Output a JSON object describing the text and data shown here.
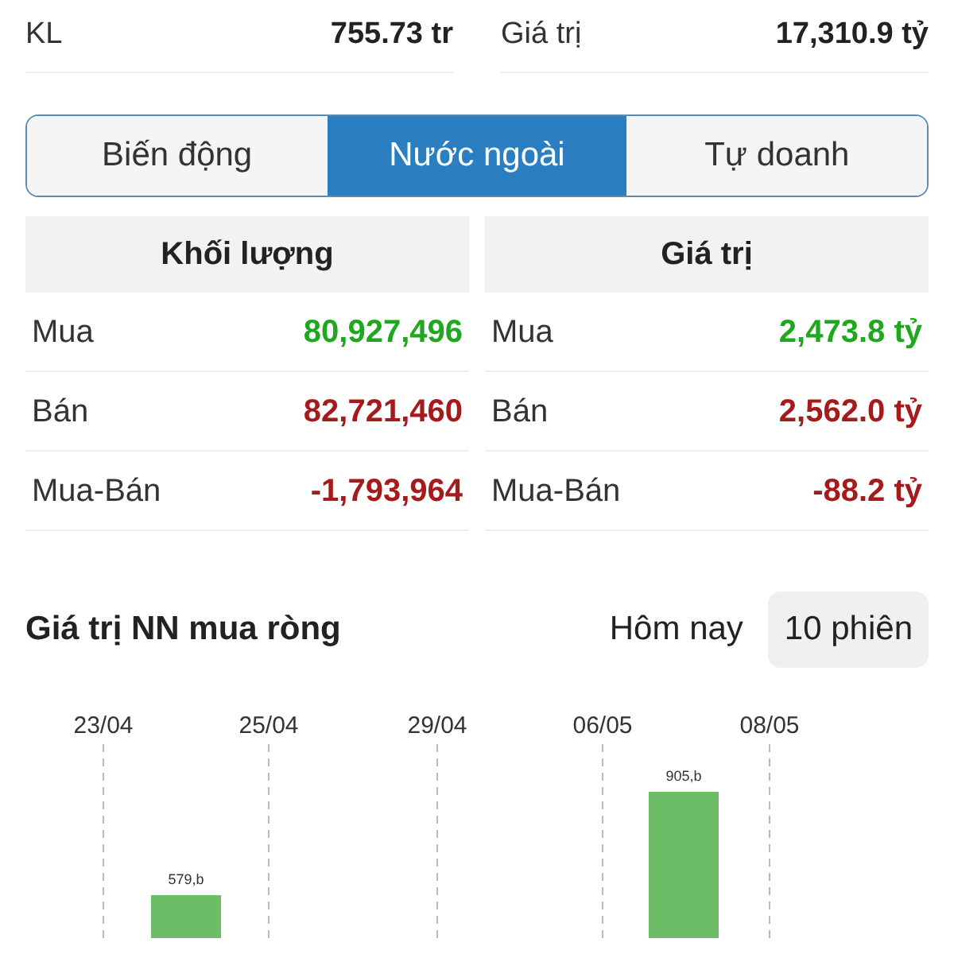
{
  "summary": [
    {
      "label": "KL",
      "value": "755.73 tr"
    },
    {
      "label": "Giá trị",
      "value": "17,310.9 tỷ"
    }
  ],
  "tabs": [
    {
      "label": "Biến động",
      "selected": false
    },
    {
      "label": "Nước ngoài",
      "selected": true
    },
    {
      "label": "Tự doanh",
      "selected": false
    }
  ],
  "tables": [
    {
      "heading": "Khối lượng",
      "rows": [
        {
          "label": "Mua",
          "value": "80,927,496",
          "kind": "buy"
        },
        {
          "label": "Bán",
          "value": "82,721,460",
          "kind": "sell"
        },
        {
          "label": "Mua-Bán",
          "value": "-1,793,964",
          "kind": "sell"
        }
      ]
    },
    {
      "heading": "Giá trị",
      "rows": [
        {
          "label": "Mua",
          "value": "2,473.8 tỷ",
          "kind": "buy"
        },
        {
          "label": "Bán",
          "value": "2,562.0 tỷ",
          "kind": "sell"
        },
        {
          "label": "Mua-Bán",
          "value": "-88.2 tỷ",
          "kind": "sell"
        }
      ]
    }
  ],
  "net_buy": {
    "title": "Giá trị NN mua ròng",
    "periods": [
      {
        "label": "Hôm nay",
        "selected": false
      },
      {
        "label": "10 phiên",
        "selected": true
      }
    ],
    "dates": [
      "23/04",
      "25/04",
      "29/04",
      "06/05",
      "08/05"
    ],
    "bar_labels": [
      "579,b",
      "905,b"
    ]
  }
}
